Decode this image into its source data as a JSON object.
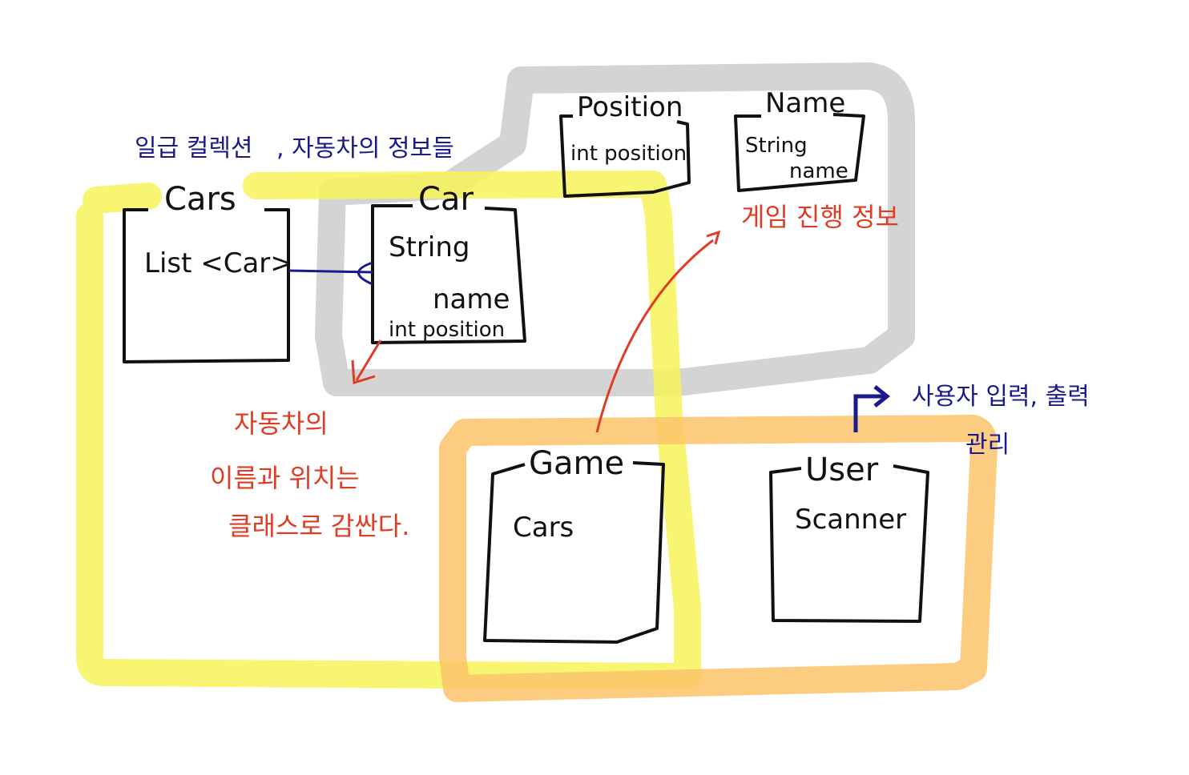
{
  "colors": {
    "ink": "#111111",
    "note_blue": "#1a1a8c",
    "note_red": "#e03b24",
    "highlight_yellow": "#f7f35a",
    "highlight_orange": "#fbc46a",
    "highlight_gray": "#cfcfcf"
  },
  "classes": {
    "cars": {
      "name": "Cars",
      "fields": [
        "List <Car>"
      ]
    },
    "car": {
      "name": "Car",
      "fields": [
        "String",
        "name",
        "int position"
      ]
    },
    "position": {
      "name": "Position",
      "fields": [
        "int position"
      ]
    },
    "name": {
      "name": "Name",
      "fields": [
        "String",
        "name"
      ]
    },
    "game": {
      "name": "Game",
      "fields": [
        "Cars"
      ]
    },
    "user": {
      "name": "User",
      "fields": [
        "Scanner"
      ]
    }
  },
  "notes": {
    "first_class_collection": "일급 컬렉션",
    "car_info": ", 자동차의 정보들",
    "game_progress": "게임 진행 정보",
    "wrap_line1": "자동차의",
    "wrap_line2": "이름과 위치는",
    "wrap_line3": "클래스로 감싼다.",
    "user_io_line1": "사용자 입력, 출력",
    "user_io_line2": "관리"
  }
}
